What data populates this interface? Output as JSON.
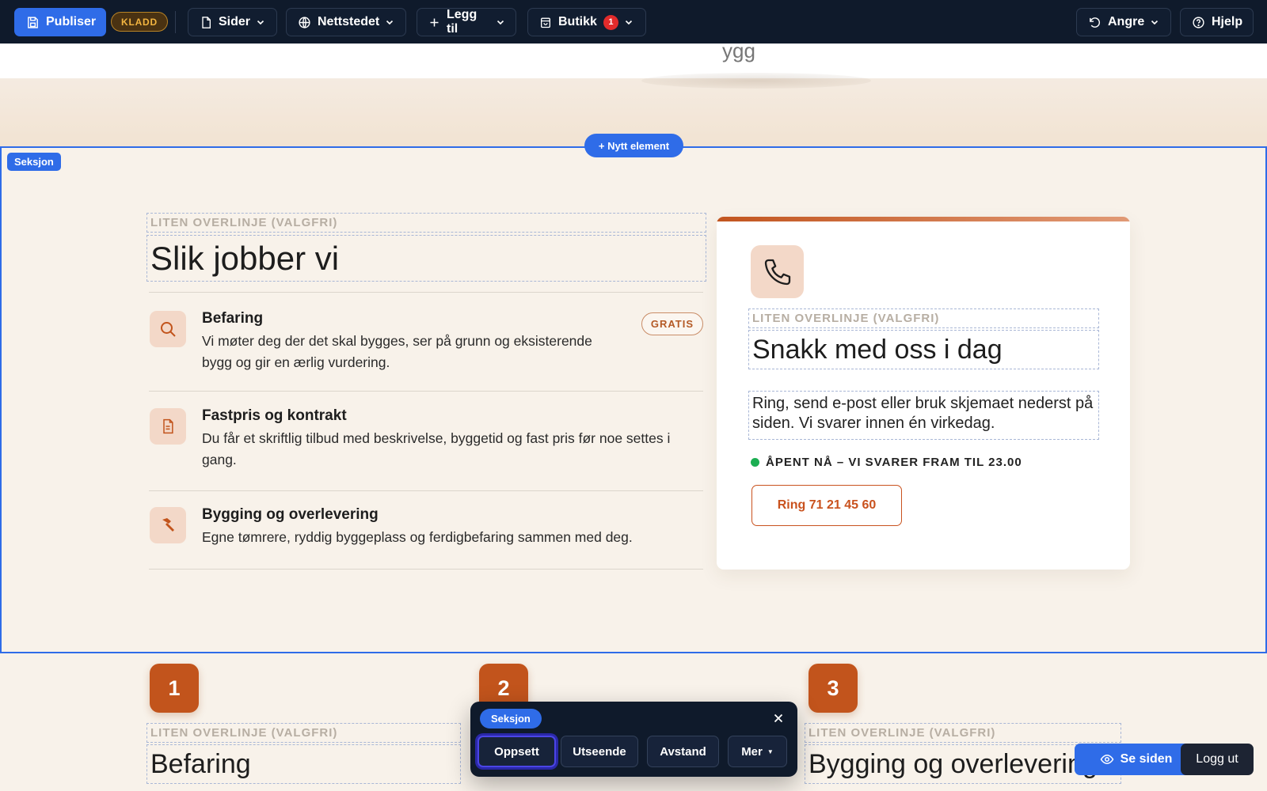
{
  "toolbar": {
    "publish_label": "Publiser",
    "draft_badge": "KLADD",
    "pages_label": "Sider",
    "site_label": "Nettstedet",
    "add_label": "Legg til",
    "shop_label": "Butikk",
    "shop_count": "1",
    "undo_label": "Angre",
    "help_label": "Hjelp"
  },
  "editor": {
    "section_tag": "Seksjon",
    "new_element_label": "+ Nytt element"
  },
  "process": {
    "eyebrow_placeholder": "LITEN OVERLINJE (VALGFRI)",
    "heading": "Slik jobber vi",
    "steps": [
      {
        "title": "Befaring",
        "text": "Vi møter deg der det skal bygges, ser på grunn og eksisterende bygg og gir en ærlig vurdering.",
        "badge": "GRATIS",
        "icon": "search-icon"
      },
      {
        "title": "Fastpris og kontrakt",
        "text": "Du får et skriftlig tilbud med beskrivelse, byggetid og fast pris før noe settes i gang.",
        "icon": "document-icon"
      },
      {
        "title": "Bygging og overlevering",
        "text": "Egne tømrere, ryddig byggeplass og ferdigbefaring sammen med deg.",
        "icon": "hammer-icon"
      }
    ]
  },
  "contact_card": {
    "icon": "phone-icon",
    "eyebrow_placeholder": "LITEN OVERLINJE (VALGFRI)",
    "heading": "Snakk med oss i dag",
    "description": "Ring, send e-post eller bruk skjemaet nederst på siden. Vi svarer innen én virkedag.",
    "status": "ÅPENT NÅ – VI SVARER FRAM TIL 23.00",
    "call_button": "Ring 71 21 45 60"
  },
  "numbered_steps": {
    "items": [
      {
        "number": "1",
        "eyebrow": "LITEN OVERLINJE (VALGFRI)",
        "heading": "Befaring"
      },
      {
        "number": "2",
        "eyebrow": "",
        "heading": ""
      },
      {
        "number": "3",
        "eyebrow": "LITEN OVERLINJE (VALGFRI)",
        "heading": "Bygging og overlevering"
      }
    ]
  },
  "section_toolbar": {
    "tag": "Seksjon",
    "tabs": [
      "Oppsett",
      "Utseende",
      "Avstand",
      "Mer"
    ]
  },
  "bottom_actions": {
    "preview_label": "Se siden",
    "logout_label": "Logg ut"
  },
  "colors": {
    "accent_blue": "#2f6ce8",
    "brand_orange": "#c2541c",
    "toolbar_bg": "#0f1a2b",
    "page_bg": "#f8f2ea",
    "status_green": "#1cae52"
  }
}
